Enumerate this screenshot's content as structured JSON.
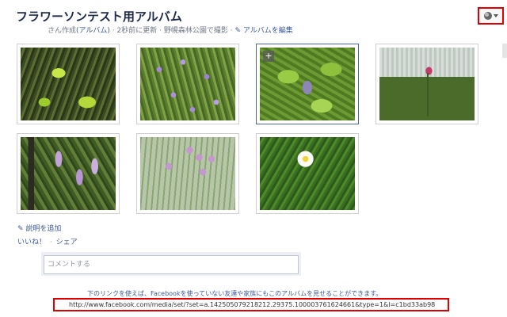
{
  "album": {
    "title": "フラワーソンテスト用アルバム",
    "meta_prefix": "さん作成",
    "meta_type": "(アルバム)",
    "meta_updated": "· 2秒前に更新 · 野幌森林公園で撮影 ·",
    "edit_label": "アルバムを編集",
    "privacy_icon": "globe-icon"
  },
  "photos": [
    {
      "alt": "flower photo 1"
    },
    {
      "alt": "flower photo 2"
    },
    {
      "alt": "flower photo 3",
      "selected": true,
      "tag_label": "+"
    },
    {
      "alt": "flower photo 4"
    },
    {
      "alt": "flower photo 5"
    },
    {
      "alt": "flower photo 6"
    },
    {
      "alt": "flower photo 7"
    }
  ],
  "actions": {
    "add_description": "説明を追加",
    "like": "いいね！",
    "separator": "·",
    "share": "シェア"
  },
  "comment": {
    "placeholder": "コメントする"
  },
  "share_link": {
    "note": "下のリンクを使えば、Facebookを使っていない友達や家族にもこのアルバムを見せることができます。",
    "url": "http://www.facebook.com/media/set/?set=a.142505079218212.29375.100003761624661&type=1&l=c1bd33ab98"
  },
  "colors": {
    "link": "#3b5998",
    "highlight_border": "#e00000"
  }
}
